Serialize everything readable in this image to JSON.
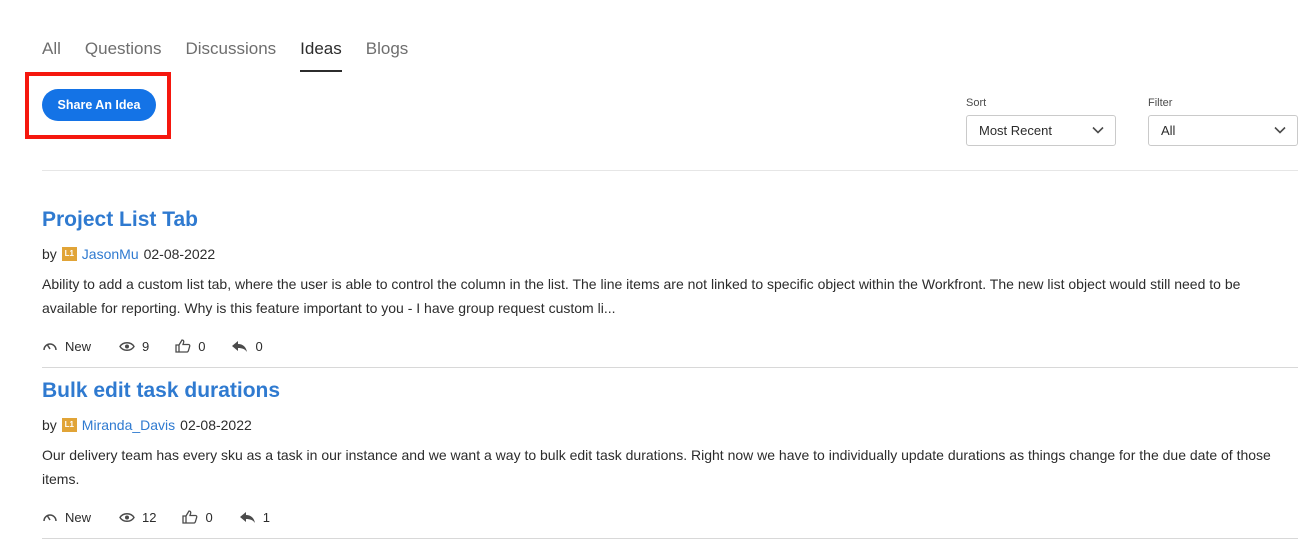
{
  "tabs": [
    {
      "label": "All",
      "active": false
    },
    {
      "label": "Questions",
      "active": false
    },
    {
      "label": "Discussions",
      "active": false
    },
    {
      "label": "Ideas",
      "active": true
    },
    {
      "label": "Blogs",
      "active": false
    }
  ],
  "share_button": {
    "label": "Share An Idea"
  },
  "sort": {
    "label": "Sort",
    "value": "Most Recent"
  },
  "filter": {
    "label": "Filter",
    "value": "All"
  },
  "posts": [
    {
      "title": "Project List Tab",
      "by": "by",
      "rank": "L1",
      "author": "JasonMu",
      "date": "02-08-2022",
      "body": "Ability to add a custom list tab, where the user is able to control the column in the list. The line items are not linked to specific object within the Workfront. The new list object would still need to be available for reporting. Why is this feature important to you - I have group request custom li...",
      "status": "New",
      "views": "9",
      "likes": "0",
      "replies": "0"
    },
    {
      "title": "Bulk edit task durations",
      "by": "by",
      "rank": "L1",
      "author": "Miranda_Davis",
      "date": "02-08-2022",
      "body": "Our delivery team has every sku as a task in our instance and we want a way to bulk edit task durations. Right now we have to individually update durations as things change for the due date of those items.",
      "status": "New",
      "views": "12",
      "likes": "0",
      "replies": "1"
    }
  ],
  "colors": {
    "accent": "#1473e6",
    "link": "#2f7ad0",
    "highlight": "#f5170e",
    "rank_badge": "#e1a437"
  }
}
